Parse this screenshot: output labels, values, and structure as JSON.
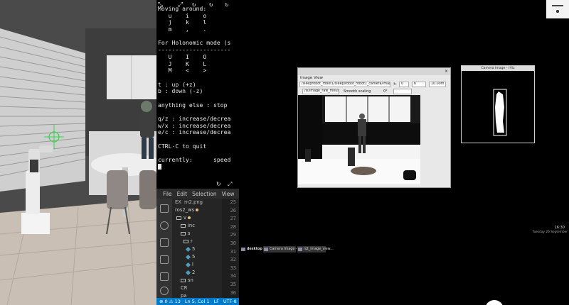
{
  "terminal": {
    "lines": [
      "Moving around:",
      "   u    i    o",
      "   j    k    l",
      "   m    ,    .",
      "",
      "For Holonomic mode (s",
      "---------------------",
      "   U    I    O",
      "   J    K    L",
      "   M    <    >",
      "",
      "t : up (+z)",
      "b : down (-z)",
      "",
      "anything else : stop",
      "",
      "q/z : increase/decrea",
      "w/x : increase/decrea",
      "e/c : increase/decrea",
      "",
      "CTRL-C to quit",
      "",
      "currently:      speed"
    ]
  },
  "vscode": {
    "menu": [
      "File",
      "Edit",
      "Selection",
      "View"
    ],
    "explorer_header": [
      "EX",
      "m2.png"
    ],
    "explorer_rows": [
      {
        "label": "ros2_ws",
        "kind": "text"
      },
      {
        "label": "v",
        "kind": "folder"
      },
      {
        "label": "inc",
        "kind": "folder"
      },
      {
        "label": "s",
        "kind": "folder"
      },
      {
        "label": "r",
        "kind": "folder"
      },
      {
        "label": "5",
        "kind": "file"
      },
      {
        "label": "5",
        "kind": "file"
      },
      {
        "label": "l",
        "kind": "file"
      },
      {
        "label": "2",
        "kind": "file"
      },
      {
        "label": "sn",
        "kind": "folder"
      },
      {
        "label": "CR",
        "kind": "text"
      },
      {
        "label": "pa",
        "kind": "text"
      }
    ],
    "line_numbers": [
      "25",
      "26",
      "27",
      "28",
      "29",
      "30",
      "31",
      "32",
      "33",
      "34",
      "35",
      "36"
    ],
    "status": {
      "problems": "⊗ 0 ⚠ 13",
      "position": "Ln 5, Col 1",
      "eol": "LF",
      "encoding": "UTF-8"
    }
  },
  "image_view": {
    "title": "Image View",
    "topic": "/sleeprobot_robot1/sleep/robot_robot1_camera/image_raw",
    "field_value_1": "0",
    "field_value_2": "6",
    "zoom": "10.00m",
    "mouse_topic": "/sl/image_raw_mouse_left",
    "smooth_label": "Smooth scaling",
    "rotation": "0°"
  },
  "camera_window": {
    "title": "Camera Image - rViz"
  },
  "taskbar": {
    "items": [
      "desktop 1",
      "Camera Image - r...",
      "rqt_image_view..."
    ],
    "time": "16:30",
    "date": "Tuesday 26 September"
  },
  "colors": {
    "vscode_blue": "#007acc",
    "terminal_text": "#e9e9e9"
  }
}
